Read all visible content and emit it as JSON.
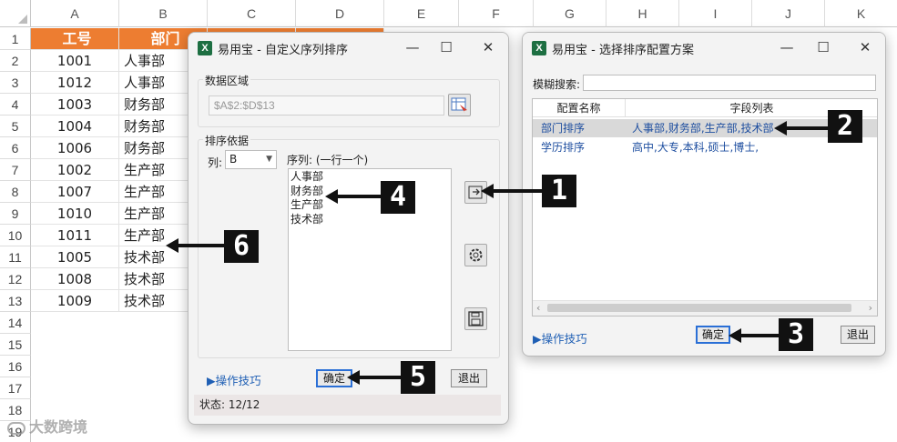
{
  "sheet": {
    "columns": [
      "A",
      "B",
      "C",
      "D",
      "E",
      "F",
      "G",
      "H",
      "I",
      "J",
      "K"
    ],
    "rows": [
      "1",
      "2",
      "3",
      "4",
      "5",
      "6",
      "7",
      "8",
      "9",
      "10",
      "11",
      "12",
      "13",
      "14",
      "15",
      "16",
      "17",
      "18",
      "19"
    ],
    "header_row": [
      "工号",
      "部门"
    ],
    "data": [
      [
        "1001",
        "人事部"
      ],
      [
        "1012",
        "人事部"
      ],
      [
        "1003",
        "财务部"
      ],
      [
        "1004",
        "财务部"
      ],
      [
        "1006",
        "财务部"
      ],
      [
        "1002",
        "生产部"
      ],
      [
        "1007",
        "生产部"
      ],
      [
        "1010",
        "生产部"
      ],
      [
        "1011",
        "生产部"
      ],
      [
        "1005",
        "技术部"
      ],
      [
        "1008",
        "技术部"
      ],
      [
        "1009",
        "技术部"
      ]
    ],
    "header_color": "#ed7d31"
  },
  "dialog1": {
    "title": "易用宝 - 自定义序列排序",
    "app_icon": "X",
    "data_area_label": "数据区域",
    "data_area_value": "$A$2:$D$13",
    "sort_basis_label": "排序依据",
    "col_label": "列:",
    "col_value": "B",
    "seq_label": "序列: (一行一个)",
    "sequence": [
      "人事部",
      "财务部",
      "生产部",
      "技术部"
    ],
    "tips_link": "▶操作技巧",
    "ok_button": "确定",
    "exit_button": "退出",
    "status": "状态: 12/12"
  },
  "dialog2": {
    "title": "易用宝 - 选择排序配置方案",
    "app_icon": "X",
    "search_label": "模糊搜索:",
    "search_value": "",
    "col_name": "配置名称",
    "col_fields": "字段列表",
    "rows": [
      {
        "name": "部门排序",
        "fields": "人事部,财务部,生产部,技术部"
      },
      {
        "name": "学历排序",
        "fields": "高中,大专,本科,硕士,博士,"
      }
    ],
    "tips_link": "▶操作技巧",
    "ok_button": "确定",
    "exit_button": "退出"
  },
  "callouts": [
    "1",
    "2",
    "3",
    "4",
    "5",
    "6"
  ],
  "watermark": "大数跨境"
}
